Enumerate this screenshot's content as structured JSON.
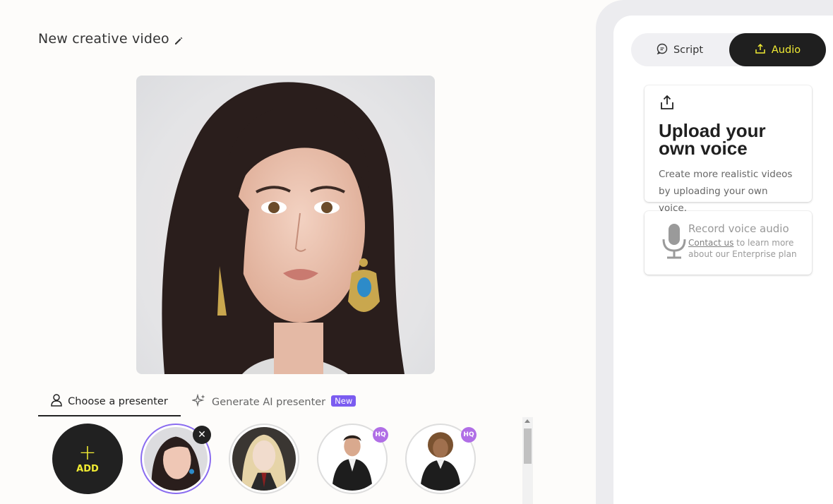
{
  "header": {
    "title": "New creative video",
    "edit_icon": "pencil-icon"
  },
  "presenter_tabs": [
    {
      "label": "Choose a presenter",
      "icon": "user-icon",
      "active": true
    },
    {
      "label": "Generate AI presenter",
      "icon": "sparkle-icon",
      "badge": "New"
    }
  ],
  "presenters": {
    "add_label": "ADD",
    "add_icon": "plus-icon",
    "hq_badge": "HQ",
    "items": [
      {
        "id": "p1",
        "selected": true,
        "removable": true
      },
      {
        "id": "p2"
      },
      {
        "id": "p3",
        "hq": true
      },
      {
        "id": "p4",
        "hq": true
      }
    ]
  },
  "panel": {
    "tabs": [
      {
        "label": "Script",
        "icon": "chat-icon"
      },
      {
        "label": "Audio",
        "icon": "upload-icon",
        "active": true
      }
    ],
    "upload_card": {
      "icon": "upload-icon",
      "title_line1": "Upload your",
      "title_line2": "own voice",
      "desc_line1": "Create more realistic videos",
      "desc_line2": "by uploading your own voice."
    },
    "record_card": {
      "icon": "microphone-icon",
      "title": "Record voice audio",
      "link": "Contact us",
      "text_line1": " to learn more",
      "text_line2": "about our Enterprise plan"
    }
  },
  "colors": {
    "accent_yellow": "#f1ec34",
    "dark": "#1f1f1f",
    "purple": "#7b5cf0",
    "hq_purple": "#b06ee6"
  }
}
